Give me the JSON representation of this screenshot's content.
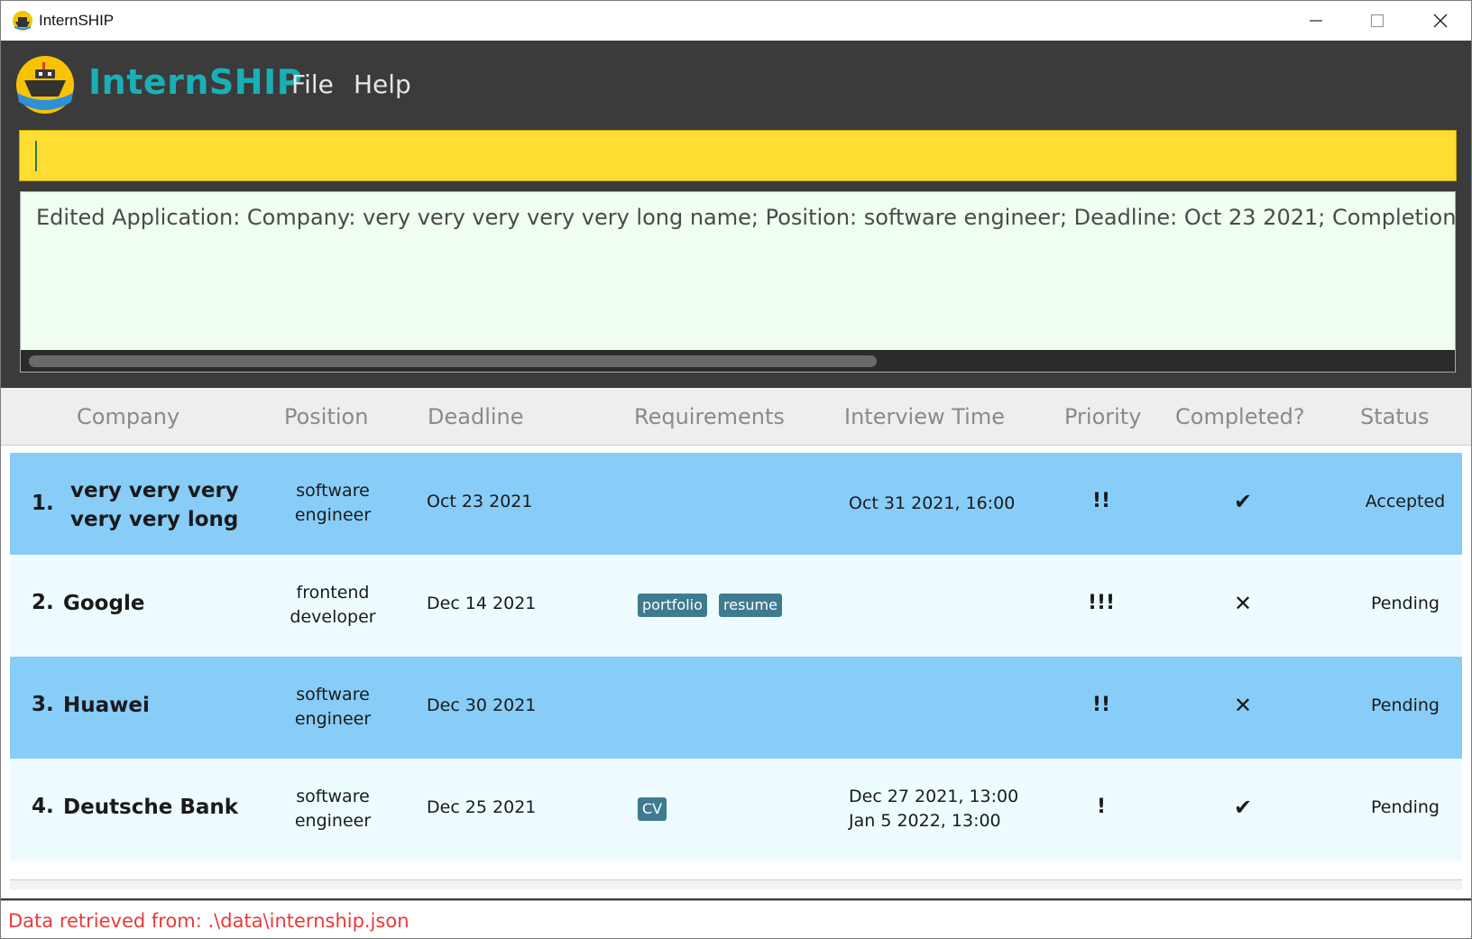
{
  "window": {
    "title": "InternSHIP"
  },
  "menubar": {
    "app_name": "InternSHIP",
    "menus": [
      "File",
      "Help"
    ]
  },
  "command_box": {
    "value": ""
  },
  "result_display": {
    "text": "Edited Application: Company: very very very very very long name; Position: software engineer; Deadline: Oct 23 2021; Completion: Comp"
  },
  "table": {
    "headers": [
      "Company",
      "Position",
      "Deadline",
      "Requirements",
      "Interview Time",
      "Priority",
      "Completed?",
      "Status"
    ],
    "rows": [
      {
        "index": "1.",
        "company_line1": "very very very",
        "company_line2": "very very long",
        "position_line1": "software",
        "position_line2": "engineer",
        "deadline": "Oct 23 2021",
        "requirements": [],
        "interview_line1": "Oct 31 2021, 16:00",
        "interview_line2": "",
        "priority": "!!",
        "completed": "✔",
        "status": "Accepted"
      },
      {
        "index": "2.",
        "company": "Google",
        "position_line1": "frontend",
        "position_line2": "developer",
        "deadline": "Dec 14 2021",
        "requirements": [
          "portfolio",
          "resume"
        ],
        "interview_line1": "",
        "interview_line2": "",
        "priority": "!!!",
        "completed": "✕",
        "status": "Pending"
      },
      {
        "index": "3.",
        "company": "Huawei",
        "position_line1": "software",
        "position_line2": "engineer",
        "deadline": "Dec 30 2021",
        "requirements": [],
        "interview_line1": "",
        "interview_line2": "",
        "priority": "!!",
        "completed": "✕",
        "status": "Pending"
      },
      {
        "index": "4.",
        "company": "Deutsche Bank",
        "position_line1": "software",
        "position_line2": "engineer",
        "deadline": "Dec 25 2021",
        "requirements": [
          "CV"
        ],
        "interview_line1": "Dec 27 2021, 13:00",
        "interview_line2": "Jan 5 2022, 13:00",
        "priority": "!",
        "completed": "✔",
        "status": "Pending"
      }
    ]
  },
  "status_bar": {
    "text": "Data retrieved from:  .\\data\\internship.json"
  },
  "colors": {
    "accent": "#19b0b5",
    "command_bg": "#ffdd33",
    "row_odd": "#88cdf8",
    "row_even": "#eefcff",
    "tag": "#3e7b91",
    "status_text": "#e83a3a"
  }
}
